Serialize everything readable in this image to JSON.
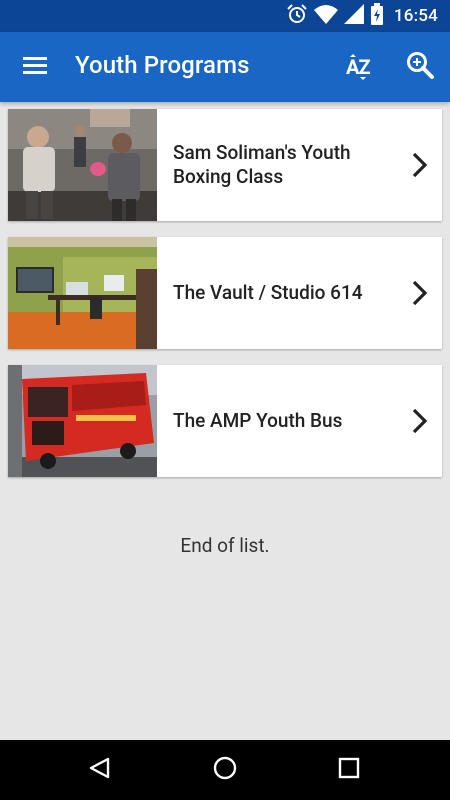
{
  "status_bar": {
    "time": "16:54",
    "icons": [
      "alarm-icon",
      "wifi-icon",
      "signal-icon",
      "battery-icon"
    ]
  },
  "app_bar": {
    "title": "Youth Programs",
    "icons": [
      "menu-icon",
      "sort-az-icon",
      "search-icon"
    ],
    "sort_label": "AZ"
  },
  "programs": [
    {
      "title": "Sam Soliman's Youth Boxing Class",
      "image": "boxing-class-photo"
    },
    {
      "title": "The Vault / Studio 614",
      "image": "studio-room-photo"
    },
    {
      "title": "The AMP Youth Bus",
      "image": "red-bus-photo"
    }
  ],
  "end_of_list": "End of list.",
  "nav_bar": {
    "icons": [
      "back-icon",
      "home-icon",
      "recents-icon"
    ]
  },
  "colors": {
    "status_bar": "#0c4596",
    "app_bar": "#1a66c5",
    "background": "#e6e6e6"
  }
}
